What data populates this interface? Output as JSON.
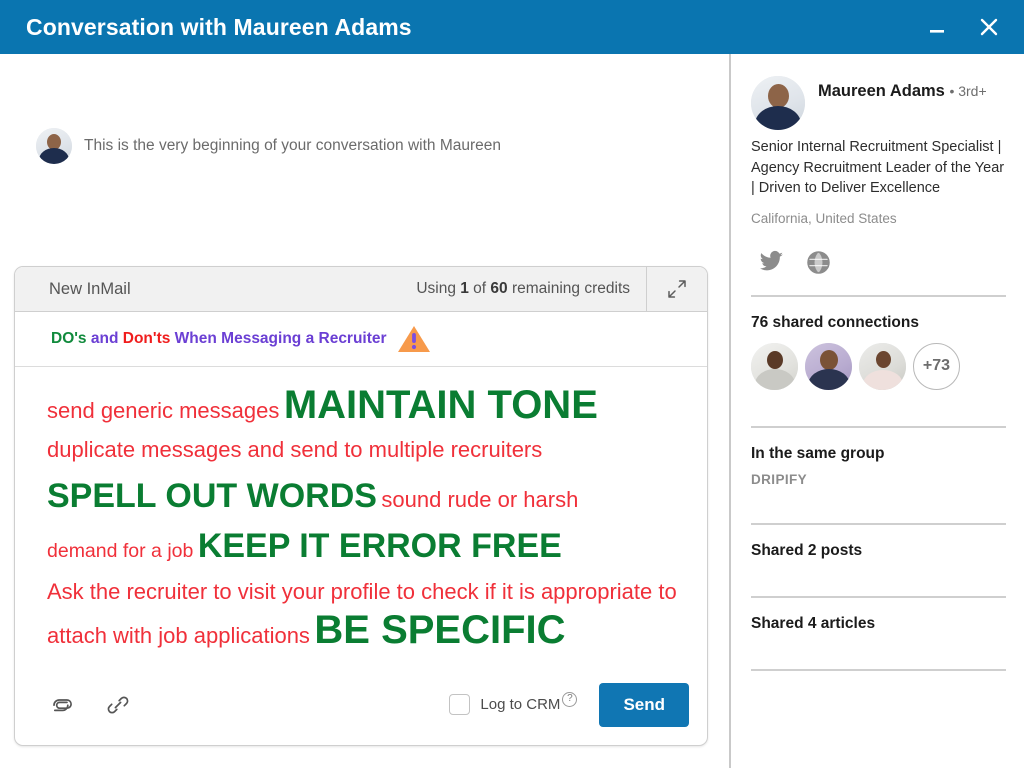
{
  "titlebar": {
    "title": "Conversation with Maureen Adams",
    "minimize_icon": "minimize-icon",
    "close_icon": "close-icon",
    "background_color": "#0a75b0"
  },
  "conversation": {
    "start_notice": "This is the very beginning of your conversation with Maureen"
  },
  "composer": {
    "label": "New InMail",
    "credits_prefix": "Using ",
    "credits_used": "1",
    "credits_middle": " of ",
    "credits_total": "60",
    "credits_suffix": " remaining credits",
    "expand_icon": "expand-icon",
    "subject": {
      "part_do": "DO's",
      "part_and": "and",
      "part_dont": "Don'ts",
      "part_rest": "When Messaging a Recruiter",
      "warning_icon": "warning-triangle-icon"
    },
    "body_lines": [
      {
        "id": "line1",
        "segments": [
          {
            "text": "send generic messages",
            "kind": "dont",
            "size": "sz-md"
          },
          {
            "text": "MAINTAIN TONE",
            "kind": "do",
            "size": "sz-xl"
          }
        ]
      },
      {
        "id": "line2",
        "segments": [
          {
            "text": "duplicate messages and send to multiple recruiters",
            "kind": "dont",
            "size": "sz-md"
          }
        ]
      },
      {
        "id": "line3",
        "segments": [
          {
            "text": "SPELL OUT WORDS",
            "kind": "do",
            "size": "sz-lg"
          },
          {
            "text": "sound rude or harsh",
            "kind": "dont",
            "size": "sz-md"
          }
        ]
      },
      {
        "id": "line4",
        "segments": [
          {
            "text": "demand for a job",
            "kind": "dont",
            "size": "sz-sm"
          },
          {
            "text": "KEEP IT ERROR FREE",
            "kind": "do",
            "size": "sz-lg"
          }
        ]
      },
      {
        "id": "line5",
        "segments": [
          {
            "text": "Ask the recruiter to visit your profile to check if it is appropriate to attach with job applications",
            "kind": "dont",
            "size": "sz-md"
          },
          {
            "text": "BE SPECIFIC",
            "kind": "do",
            "size": "sz-xl"
          }
        ]
      }
    ],
    "footer": {
      "attachment_icon": "paperclip-icon",
      "link_icon": "link-icon",
      "crm_label": "Log to CRM",
      "crm_help_icon": "help-circle-icon",
      "crm_checked": false,
      "send_label": "Send",
      "send_color": "#1076b3"
    }
  },
  "sidebar": {
    "profile": {
      "avatar": "profile-avatar",
      "name": "Maureen Adams",
      "degree": "• 3rd+",
      "headline": "Senior Internal Recruitment Specialist | Agency Recruitment Leader of the Year | Driven to Deliver Excellence",
      "location": "California, United States",
      "social": [
        {
          "name": "twitter-icon"
        },
        {
          "name": "website-globe-icon"
        }
      ]
    },
    "shared_connections": {
      "title": "76 shared connections",
      "avatars": [
        "connection-avatar-1",
        "connection-avatar-2",
        "connection-avatar-3"
      ],
      "more_count": "+73"
    },
    "same_group": {
      "title": "In the same group",
      "group_name": "DRIPIFY"
    },
    "shared_posts": {
      "title": "Shared 2 posts"
    },
    "shared_articles": {
      "title": "Shared 4 articles"
    }
  },
  "colors": {
    "brand_blue": "#0a75b0",
    "do_green": "#0a7d32",
    "dont_red": "#f0303a",
    "subject_purple": "#6b3fd4",
    "warning_orange": "#f79a4b"
  }
}
